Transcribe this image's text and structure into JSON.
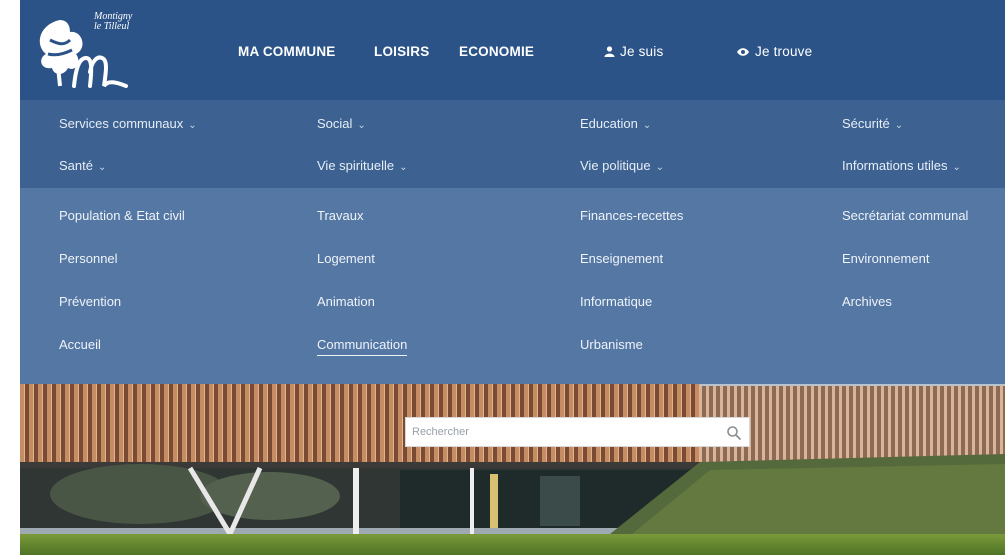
{
  "logo": {
    "line1": "Montigny",
    "line2": "le Tilleul"
  },
  "nav": {
    "commune": "MA COMMUNE",
    "loisirs": "LOISIRS",
    "economie": "ECONOMIE",
    "je_suis": "Je suis",
    "je_trouve": "Je trouve"
  },
  "categories": {
    "row1": [
      "Services communaux",
      "Social",
      "Education",
      "Sécurité"
    ],
    "row2": [
      "Santé",
      "Vie spirituelle",
      "Vie politique",
      "Informations utiles"
    ]
  },
  "submenu": {
    "col1": [
      "Population & Etat civil",
      "Personnel",
      "Prévention",
      "Accueil"
    ],
    "col2": [
      "Travaux",
      "Logement",
      "Animation",
      "Communication"
    ],
    "col3": [
      "Finances-recettes",
      "Enseignement",
      "Informatique",
      "Urbanisme"
    ],
    "col4": [
      "Secrétariat communal",
      "Environnement",
      "Archives"
    ]
  },
  "search": {
    "placeholder": "Rechercher"
  },
  "colors": {
    "header": "#2b5387",
    "category_band": "#3d6292",
    "submenu_band": "#5577a3"
  }
}
